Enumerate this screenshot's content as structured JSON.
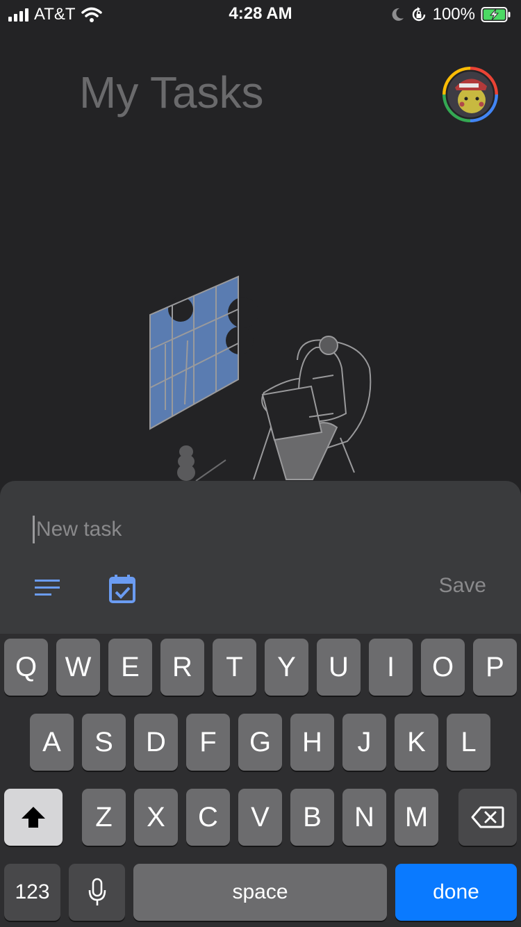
{
  "status_bar": {
    "carrier": "AT&T",
    "time": "4:28 AM",
    "battery": "100%",
    "icons": [
      "signal-icon",
      "wifi-icon",
      "moon-icon",
      "rotation-lock-icon",
      "battery-charging-icon"
    ]
  },
  "header": {
    "title": "My Tasks"
  },
  "new_task": {
    "placeholder": "New task",
    "value": "",
    "save_label": "Save",
    "icons": [
      "details-icon",
      "calendar-check-icon"
    ]
  },
  "keyboard": {
    "row1": [
      "Q",
      "W",
      "E",
      "R",
      "T",
      "Y",
      "U",
      "I",
      "O",
      "P"
    ],
    "row2": [
      "A",
      "S",
      "D",
      "F",
      "G",
      "H",
      "J",
      "K",
      "L"
    ],
    "row3": [
      "Z",
      "X",
      "C",
      "V",
      "B",
      "N",
      "M"
    ],
    "numbers_label": "123",
    "space_label": "space",
    "done_label": "done",
    "icons": [
      "shift-icon",
      "backspace-icon",
      "microphone-icon"
    ]
  },
  "colors": {
    "background": "#232325",
    "sheet": "#3a3b3d",
    "accent_blue": "#6b9cf2",
    "done_blue": "#0a7aff"
  }
}
